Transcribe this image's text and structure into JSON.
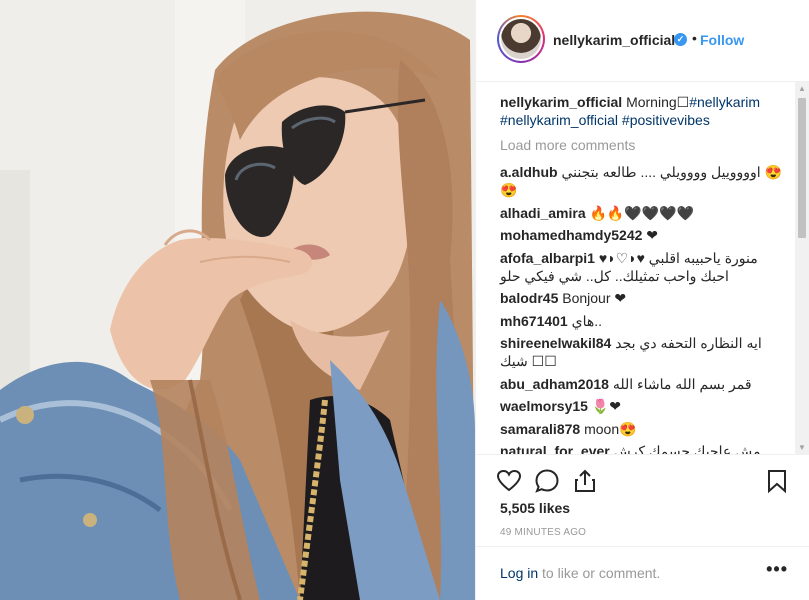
{
  "post": {
    "username": "nellykarim_official",
    "verified_icon": "verified-badge-icon",
    "separator": "•",
    "follow_label": "Follow"
  },
  "caption": {
    "username": "nellykarim_official",
    "text": "Morning☐",
    "tags": [
      "#nellykarim",
      "#nellykarim_official",
      "#positivevibes"
    ]
  },
  "load_more_label": "Load more comments",
  "comments": [
    {
      "user": "a.aldhub",
      "text": "اووووييل وووويلي .... طالعه بتجنني 😍😍"
    },
    {
      "user": "alhadi_amira",
      "text": "🔥🔥🖤🖤🖤🖤"
    },
    {
      "user": "mohamedhamdy5242",
      "text": "❤"
    },
    {
      "user": "afofa_albarpi1",
      "text": "منورة ياحبيبه اقلبي ♥◗♡◗♥ احبك واحب تمثيلك.. كل.. شي فيكي حلو"
    },
    {
      "user": "balodr45",
      "text": "Bonjour ❤"
    },
    {
      "user": "mh671401",
      "text": "هاي.."
    },
    {
      "user": "shireenelwakil84",
      "text": "ايه النظاره التحفه دي بجد شيك ☐☐"
    },
    {
      "user": "abu_adham2018",
      "text": "قمر بسم الله ماشاء الله"
    },
    {
      "user": "waelmorsy15",
      "text": "🌷❤"
    },
    {
      "user": "samarali878",
      "text": "moon😍"
    },
    {
      "user": "natural_for_ever",
      "text": "مش عاجبك جسمك كرش وزوائد"
    }
  ],
  "actions": {
    "like_icon": "heart-icon",
    "comment_icon": "comment-icon",
    "share_icon": "share-icon",
    "save_icon": "bookmark-icon"
  },
  "likes": "5,505 likes",
  "timestamp": "49 MINUTES AGO",
  "footer": {
    "login_link": "Log in",
    "login_rest": " to like or comment.",
    "more_label": "•••"
  },
  "colors": {
    "link_blue": "#3897f0",
    "tag_blue": "#003569",
    "muted": "#999999",
    "text": "#262626"
  }
}
